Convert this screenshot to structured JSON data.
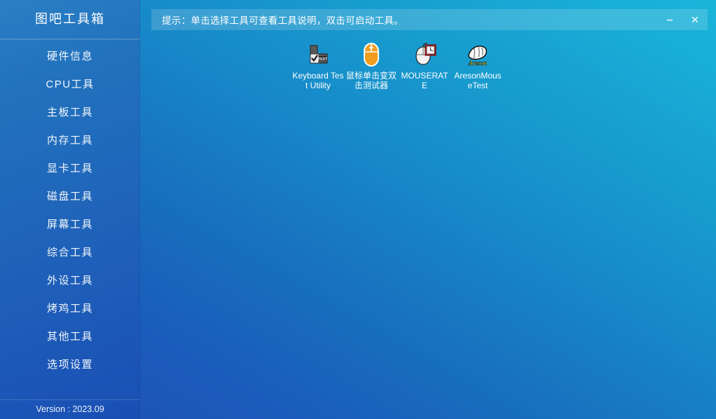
{
  "sidebar": {
    "title": "图吧工具箱",
    "items": [
      {
        "label": "硬件信息",
        "name": "hardware-info"
      },
      {
        "label": "CPU工具",
        "name": "cpu-tools"
      },
      {
        "label": "主板工具",
        "name": "motherboard-tools"
      },
      {
        "label": "内存工具",
        "name": "memory-tools"
      },
      {
        "label": "显卡工具",
        "name": "gpu-tools"
      },
      {
        "label": "磁盘工具",
        "name": "disk-tools"
      },
      {
        "label": "屏幕工具",
        "name": "screen-tools"
      },
      {
        "label": "综合工具",
        "name": "general-tools"
      },
      {
        "label": "外设工具",
        "name": "peripheral-tools"
      },
      {
        "label": "烤鸡工具",
        "name": "stress-test-tools"
      },
      {
        "label": "其他工具",
        "name": "other-tools"
      },
      {
        "label": "选项设置",
        "name": "settings"
      }
    ],
    "version": "Version : 2023.09"
  },
  "header": {
    "hint": "提示：单击选择工具可查看工具说明，双击可启动工具。",
    "minimize_label": "–",
    "close_label": "✕"
  },
  "main": {
    "tools": [
      {
        "label": "Keyboard Test Utility",
        "icon": "keyboard-test-icon"
      },
      {
        "label": "鼠标单击变双击测试器",
        "icon": "orange-mouse-icon"
      },
      {
        "label": "MOUSERATE",
        "icon": "mouse-rate-icon"
      },
      {
        "label": "AresonMouseTest",
        "icon": "areson-mouse-icon"
      }
    ]
  },
  "colors": {
    "sidebar_top": "#2a7fc4",
    "sidebar_bottom": "#1a4fb4",
    "main_bottom_left": "#1e55b6",
    "main_top_right": "#1ab4d9",
    "hint_bar": "rgba(255,255,255,0.16)",
    "accent_orange": "#f2a23c",
    "accent_red": "#b52225",
    "accent_yellow": "#f5e11e"
  }
}
